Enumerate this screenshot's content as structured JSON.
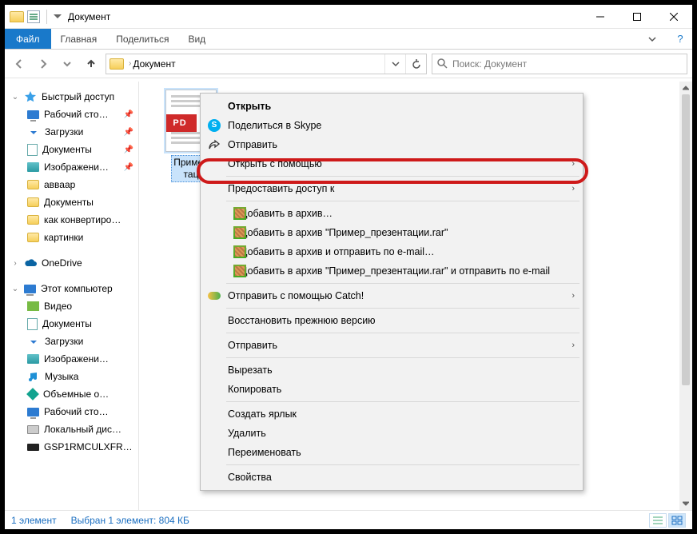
{
  "title": "Документ",
  "ribbon": {
    "file": "Файл",
    "tabs": [
      "Главная",
      "Поделиться",
      "Вид"
    ]
  },
  "breadcrumb": "Документ",
  "search_placeholder": "Поиск: Документ",
  "sidebar": {
    "quick": "Быстрый доступ",
    "items_quick": [
      {
        "label": "Рабочий сто…",
        "icon": "desktop",
        "pin": true
      },
      {
        "label": "Загрузки",
        "icon": "downloads",
        "pin": true
      },
      {
        "label": "Документы",
        "icon": "docs",
        "pin": true
      },
      {
        "label": "Изображени…",
        "icon": "images",
        "pin": true
      },
      {
        "label": "авваар",
        "icon": "folder"
      },
      {
        "label": "Документы",
        "icon": "folder"
      },
      {
        "label": "как конвертиро…",
        "icon": "folder"
      },
      {
        "label": "картинки",
        "icon": "folder"
      }
    ],
    "onedrive": "OneDrive",
    "pc": "Этот компьютер",
    "items_pc": [
      {
        "label": "Видео",
        "icon": "video"
      },
      {
        "label": "Документы",
        "icon": "docs"
      },
      {
        "label": "Загрузки",
        "icon": "downloads"
      },
      {
        "label": "Изображени…",
        "icon": "images"
      },
      {
        "label": "Музыка",
        "icon": "music"
      },
      {
        "label": "Объемные о…",
        "icon": "cube"
      },
      {
        "label": "Рабочий сто…",
        "icon": "desktop"
      },
      {
        "label": "Локальный дис…",
        "icon": "disk"
      },
      {
        "label": "GSP1RMCULXFR…",
        "icon": "usb"
      }
    ]
  },
  "file": {
    "name_l1": "Пример",
    "name_l2": "тац",
    "badge": "PD"
  },
  "context_menu": [
    {
      "type": "item",
      "label": "Открыть",
      "bold": true
    },
    {
      "type": "item",
      "label": "Поделиться в Skype",
      "icon": "skype"
    },
    {
      "type": "item",
      "label": "Отправить",
      "icon": "share"
    },
    {
      "type": "item",
      "label": "Открыть с помощью",
      "arrow": true,
      "hi": true
    },
    {
      "type": "sep"
    },
    {
      "type": "item",
      "label": "Предоставить доступ к",
      "arrow": true
    },
    {
      "type": "sep"
    },
    {
      "type": "item",
      "label": "Добавить в архив…",
      "icon": "rar"
    },
    {
      "type": "item",
      "label": "Добавить в архив \"Пример_презентации.rar\"",
      "icon": "rar"
    },
    {
      "type": "item",
      "label": "Добавить в архив и отправить по e-mail…",
      "icon": "rar"
    },
    {
      "type": "item",
      "label": "Добавить в архив \"Пример_презентации.rar\" и отправить по e-mail",
      "icon": "rar"
    },
    {
      "type": "sep"
    },
    {
      "type": "item",
      "label": "Отправить с помощью Catch!",
      "icon": "catch",
      "arrow": true
    },
    {
      "type": "sep"
    },
    {
      "type": "item",
      "label": "Восстановить прежнюю версию"
    },
    {
      "type": "sep"
    },
    {
      "type": "item",
      "label": "Отправить",
      "arrow": true
    },
    {
      "type": "sep"
    },
    {
      "type": "item",
      "label": "Вырезать"
    },
    {
      "type": "item",
      "label": "Копировать"
    },
    {
      "type": "sep"
    },
    {
      "type": "item",
      "label": "Создать ярлык"
    },
    {
      "type": "item",
      "label": "Удалить"
    },
    {
      "type": "item",
      "label": "Переименовать"
    },
    {
      "type": "sep"
    },
    {
      "type": "item",
      "label": "Свойства"
    }
  ],
  "status": {
    "count": "1 элемент",
    "selection": "Выбран 1 элемент: 804 КБ"
  }
}
